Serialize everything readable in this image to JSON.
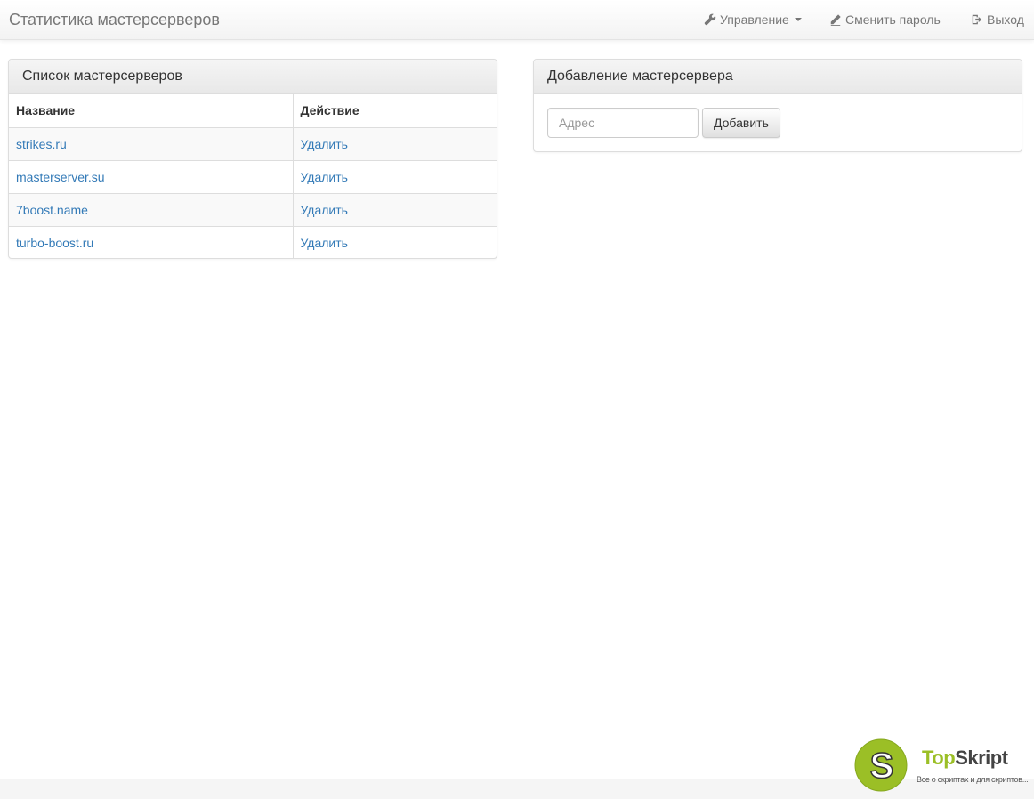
{
  "navbar": {
    "brand": "Статистика мастерсерверов",
    "manage": {
      "label": "Управление",
      "icon": "wrench-icon"
    },
    "change_password": {
      "label": "Сменить пароль",
      "icon": "pencil-icon"
    },
    "logout": {
      "label": "Выход",
      "icon": "logout-icon"
    }
  },
  "list_panel": {
    "title": "Список мастерсерверов",
    "columns": [
      "Название",
      "Действие"
    ],
    "rows": [
      {
        "name": "strikes.ru",
        "action": "Удалить"
      },
      {
        "name": "masterserver.su",
        "action": "Удалить"
      },
      {
        "name": "7boost.name",
        "action": "Удалить"
      },
      {
        "name": "turbo-boost.ru",
        "action": "Удалить"
      }
    ]
  },
  "add_panel": {
    "title": "Добавление мастерсервера",
    "address_placeholder": "Адрес",
    "address_value": "",
    "add_button": "Добавить"
  },
  "watermark": {
    "logo_letter": "S",
    "title_part1": "Top",
    "title_part2": "Skript",
    "subtitle": "Все о скриптах и для скриптов..."
  },
  "colors": {
    "link": "#337ab7",
    "brand_text": "#777777",
    "watermark_green": "#9bbf26"
  }
}
